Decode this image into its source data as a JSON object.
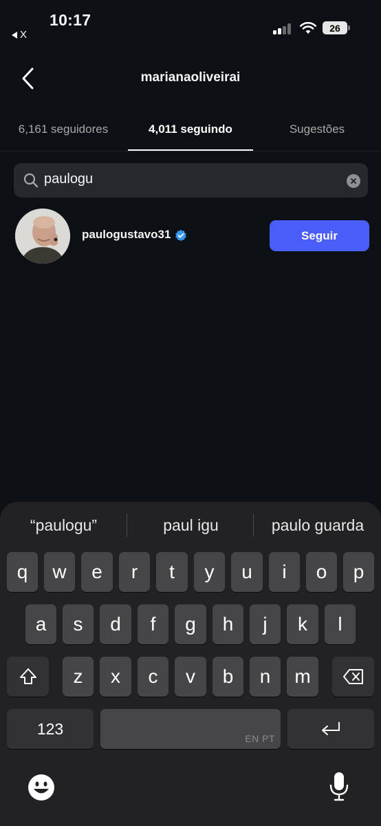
{
  "status_bar": {
    "time": "10:17",
    "back_app_label": "X",
    "battery_level": "26"
  },
  "header": {
    "title": "marianaoliveirai"
  },
  "tabs": [
    {
      "label": "6,161 seguidores",
      "active": false
    },
    {
      "label": "4,011 seguindo",
      "active": true
    },
    {
      "label": "Sugestões",
      "active": false
    }
  ],
  "search": {
    "value": "paulogu",
    "icon": "search-icon",
    "clear_icon": "clear-icon"
  },
  "results": [
    {
      "username": "paulogustavo31",
      "verified": true,
      "button_label": "Seguir"
    }
  ],
  "keyboard": {
    "suggestions": [
      "“paulogu”",
      "paul igu",
      "paulo guarda"
    ],
    "row1": [
      "q",
      "w",
      "e",
      "r",
      "t",
      "y",
      "u",
      "i",
      "o",
      "p"
    ],
    "row2": [
      "a",
      "s",
      "d",
      "f",
      "g",
      "h",
      "j",
      "k",
      "l"
    ],
    "row3": [
      "z",
      "x",
      "c",
      "v",
      "b",
      "n",
      "m"
    ],
    "numbers_key": "123",
    "space_language": "EN PT"
  },
  "colors": {
    "background": "#0c1014",
    "accent_button": "#4a5df9",
    "verified_badge": "#3897f0"
  }
}
